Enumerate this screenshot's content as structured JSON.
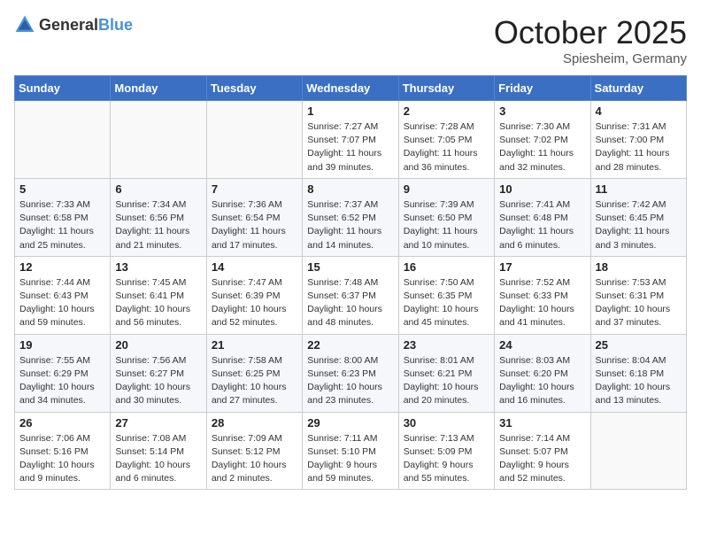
{
  "header": {
    "logo": {
      "general": "General",
      "blue": "Blue"
    },
    "title": "October 2025",
    "location": "Spiesheim, Germany"
  },
  "days_of_week": [
    "Sunday",
    "Monday",
    "Tuesday",
    "Wednesday",
    "Thursday",
    "Friday",
    "Saturday"
  ],
  "weeks": [
    [
      {
        "day": "",
        "info": ""
      },
      {
        "day": "",
        "info": ""
      },
      {
        "day": "",
        "info": ""
      },
      {
        "day": "1",
        "info": "Sunrise: 7:27 AM\nSunset: 7:07 PM\nDaylight: 11 hours and 39 minutes."
      },
      {
        "day": "2",
        "info": "Sunrise: 7:28 AM\nSunset: 7:05 PM\nDaylight: 11 hours and 36 minutes."
      },
      {
        "day": "3",
        "info": "Sunrise: 7:30 AM\nSunset: 7:02 PM\nDaylight: 11 hours and 32 minutes."
      },
      {
        "day": "4",
        "info": "Sunrise: 7:31 AM\nSunset: 7:00 PM\nDaylight: 11 hours and 28 minutes."
      }
    ],
    [
      {
        "day": "5",
        "info": "Sunrise: 7:33 AM\nSunset: 6:58 PM\nDaylight: 11 hours and 25 minutes."
      },
      {
        "day": "6",
        "info": "Sunrise: 7:34 AM\nSunset: 6:56 PM\nDaylight: 11 hours and 21 minutes."
      },
      {
        "day": "7",
        "info": "Sunrise: 7:36 AM\nSunset: 6:54 PM\nDaylight: 11 hours and 17 minutes."
      },
      {
        "day": "8",
        "info": "Sunrise: 7:37 AM\nSunset: 6:52 PM\nDaylight: 11 hours and 14 minutes."
      },
      {
        "day": "9",
        "info": "Sunrise: 7:39 AM\nSunset: 6:50 PM\nDaylight: 11 hours and 10 minutes."
      },
      {
        "day": "10",
        "info": "Sunrise: 7:41 AM\nSunset: 6:48 PM\nDaylight: 11 hours and 6 minutes."
      },
      {
        "day": "11",
        "info": "Sunrise: 7:42 AM\nSunset: 6:45 PM\nDaylight: 11 hours and 3 minutes."
      }
    ],
    [
      {
        "day": "12",
        "info": "Sunrise: 7:44 AM\nSunset: 6:43 PM\nDaylight: 10 hours and 59 minutes."
      },
      {
        "day": "13",
        "info": "Sunrise: 7:45 AM\nSunset: 6:41 PM\nDaylight: 10 hours and 56 minutes."
      },
      {
        "day": "14",
        "info": "Sunrise: 7:47 AM\nSunset: 6:39 PM\nDaylight: 10 hours and 52 minutes."
      },
      {
        "day": "15",
        "info": "Sunrise: 7:48 AM\nSunset: 6:37 PM\nDaylight: 10 hours and 48 minutes."
      },
      {
        "day": "16",
        "info": "Sunrise: 7:50 AM\nSunset: 6:35 PM\nDaylight: 10 hours and 45 minutes."
      },
      {
        "day": "17",
        "info": "Sunrise: 7:52 AM\nSunset: 6:33 PM\nDaylight: 10 hours and 41 minutes."
      },
      {
        "day": "18",
        "info": "Sunrise: 7:53 AM\nSunset: 6:31 PM\nDaylight: 10 hours and 37 minutes."
      }
    ],
    [
      {
        "day": "19",
        "info": "Sunrise: 7:55 AM\nSunset: 6:29 PM\nDaylight: 10 hours and 34 minutes."
      },
      {
        "day": "20",
        "info": "Sunrise: 7:56 AM\nSunset: 6:27 PM\nDaylight: 10 hours and 30 minutes."
      },
      {
        "day": "21",
        "info": "Sunrise: 7:58 AM\nSunset: 6:25 PM\nDaylight: 10 hours and 27 minutes."
      },
      {
        "day": "22",
        "info": "Sunrise: 8:00 AM\nSunset: 6:23 PM\nDaylight: 10 hours and 23 minutes."
      },
      {
        "day": "23",
        "info": "Sunrise: 8:01 AM\nSunset: 6:21 PM\nDaylight: 10 hours and 20 minutes."
      },
      {
        "day": "24",
        "info": "Sunrise: 8:03 AM\nSunset: 6:20 PM\nDaylight: 10 hours and 16 minutes."
      },
      {
        "day": "25",
        "info": "Sunrise: 8:04 AM\nSunset: 6:18 PM\nDaylight: 10 hours and 13 minutes."
      }
    ],
    [
      {
        "day": "26",
        "info": "Sunrise: 7:06 AM\nSunset: 5:16 PM\nDaylight: 10 hours and 9 minutes."
      },
      {
        "day": "27",
        "info": "Sunrise: 7:08 AM\nSunset: 5:14 PM\nDaylight: 10 hours and 6 minutes."
      },
      {
        "day": "28",
        "info": "Sunrise: 7:09 AM\nSunset: 5:12 PM\nDaylight: 10 hours and 2 minutes."
      },
      {
        "day": "29",
        "info": "Sunrise: 7:11 AM\nSunset: 5:10 PM\nDaylight: 9 hours and 59 minutes."
      },
      {
        "day": "30",
        "info": "Sunrise: 7:13 AM\nSunset: 5:09 PM\nDaylight: 9 hours and 55 minutes."
      },
      {
        "day": "31",
        "info": "Sunrise: 7:14 AM\nSunset: 5:07 PM\nDaylight: 9 hours and 52 minutes."
      },
      {
        "day": "",
        "info": ""
      }
    ]
  ]
}
